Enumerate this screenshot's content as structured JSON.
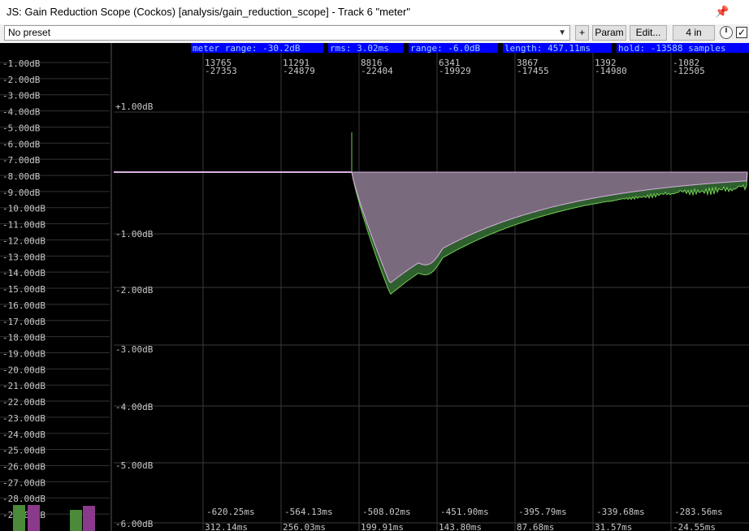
{
  "window": {
    "title": "JS: Gain Reduction Scope (Cockos) [analysis/gain_reduction_scope] - Track 6 \"meter\""
  },
  "toolbar": {
    "preset": "No preset",
    "plus_label": "+",
    "param_label": "Param",
    "edit_label": "Edit...",
    "io_label": "4 in",
    "bypass_checked": true
  },
  "status": {
    "meter_range": "meter range: -30.2dB",
    "rms": "rms: 3.02ms",
    "range": "range: -6.0dB",
    "length": "length: 457.11ms",
    "hold": "hold: -13588 samples"
  },
  "meter": {
    "labels": [
      "-1.00dB",
      "-2.00dB",
      "-3.00dB",
      "-4.00dB",
      "-5.00dB",
      "-6.00dB",
      "-7.00dB",
      "-8.00dB",
      "-9.00dB",
      "-10.00dB",
      "-11.00dB",
      "-12.00dB",
      "-13.00dB",
      "-14.00dB",
      "-15.00dB",
      "-16.00dB",
      "-17.00dB",
      "-18.00dB",
      "-19.00dB",
      "-20.00dB",
      "-21.00dB",
      "-22.00dB",
      "-23.00dB",
      "-24.00dB",
      "-25.00dB",
      "-26.00dB",
      "-27.00dB",
      "-28.00dB",
      "-29.00dB"
    ]
  },
  "scope": {
    "db_labels": [
      "+1.00dB",
      "-1.00dB",
      "-2.00dB",
      "-3.00dB",
      "-4.00dB",
      "-5.00dB",
      "-6.00dB"
    ],
    "sample_top": [
      "13765",
      "11291",
      "8816",
      "6341",
      "3867",
      "1392",
      "-1082"
    ],
    "sample_bottom": [
      "-27353",
      "-24879",
      "-22404",
      "-19929",
      "-17455",
      "-14980",
      "-12505"
    ],
    "time_neg": [
      "-620.25ms",
      "-564.13ms",
      "-508.02ms",
      "-451.90ms",
      "-395.79ms",
      "-339.68ms",
      "-283.56ms"
    ],
    "time_pos": [
      "312.14ms",
      "256.03ms",
      "199.91ms",
      "143.80ms",
      "87.68ms",
      "31.57ms",
      "-24.55ms"
    ]
  },
  "colors": {
    "background": "#000000",
    "grid": "#3a3a3a",
    "axis_text": "#c8c8c8",
    "status_bg": "#0000ff",
    "status_text": "#9fd6ff",
    "reduction_fill": "#7a6a7e",
    "reduction_line": "#d8b0e0",
    "gain_fill": "#2f5f2f",
    "gain_line": "#6fcf4f",
    "meter_green": "#4a8a3a",
    "meter_purple": "#8a3a8a"
  }
}
